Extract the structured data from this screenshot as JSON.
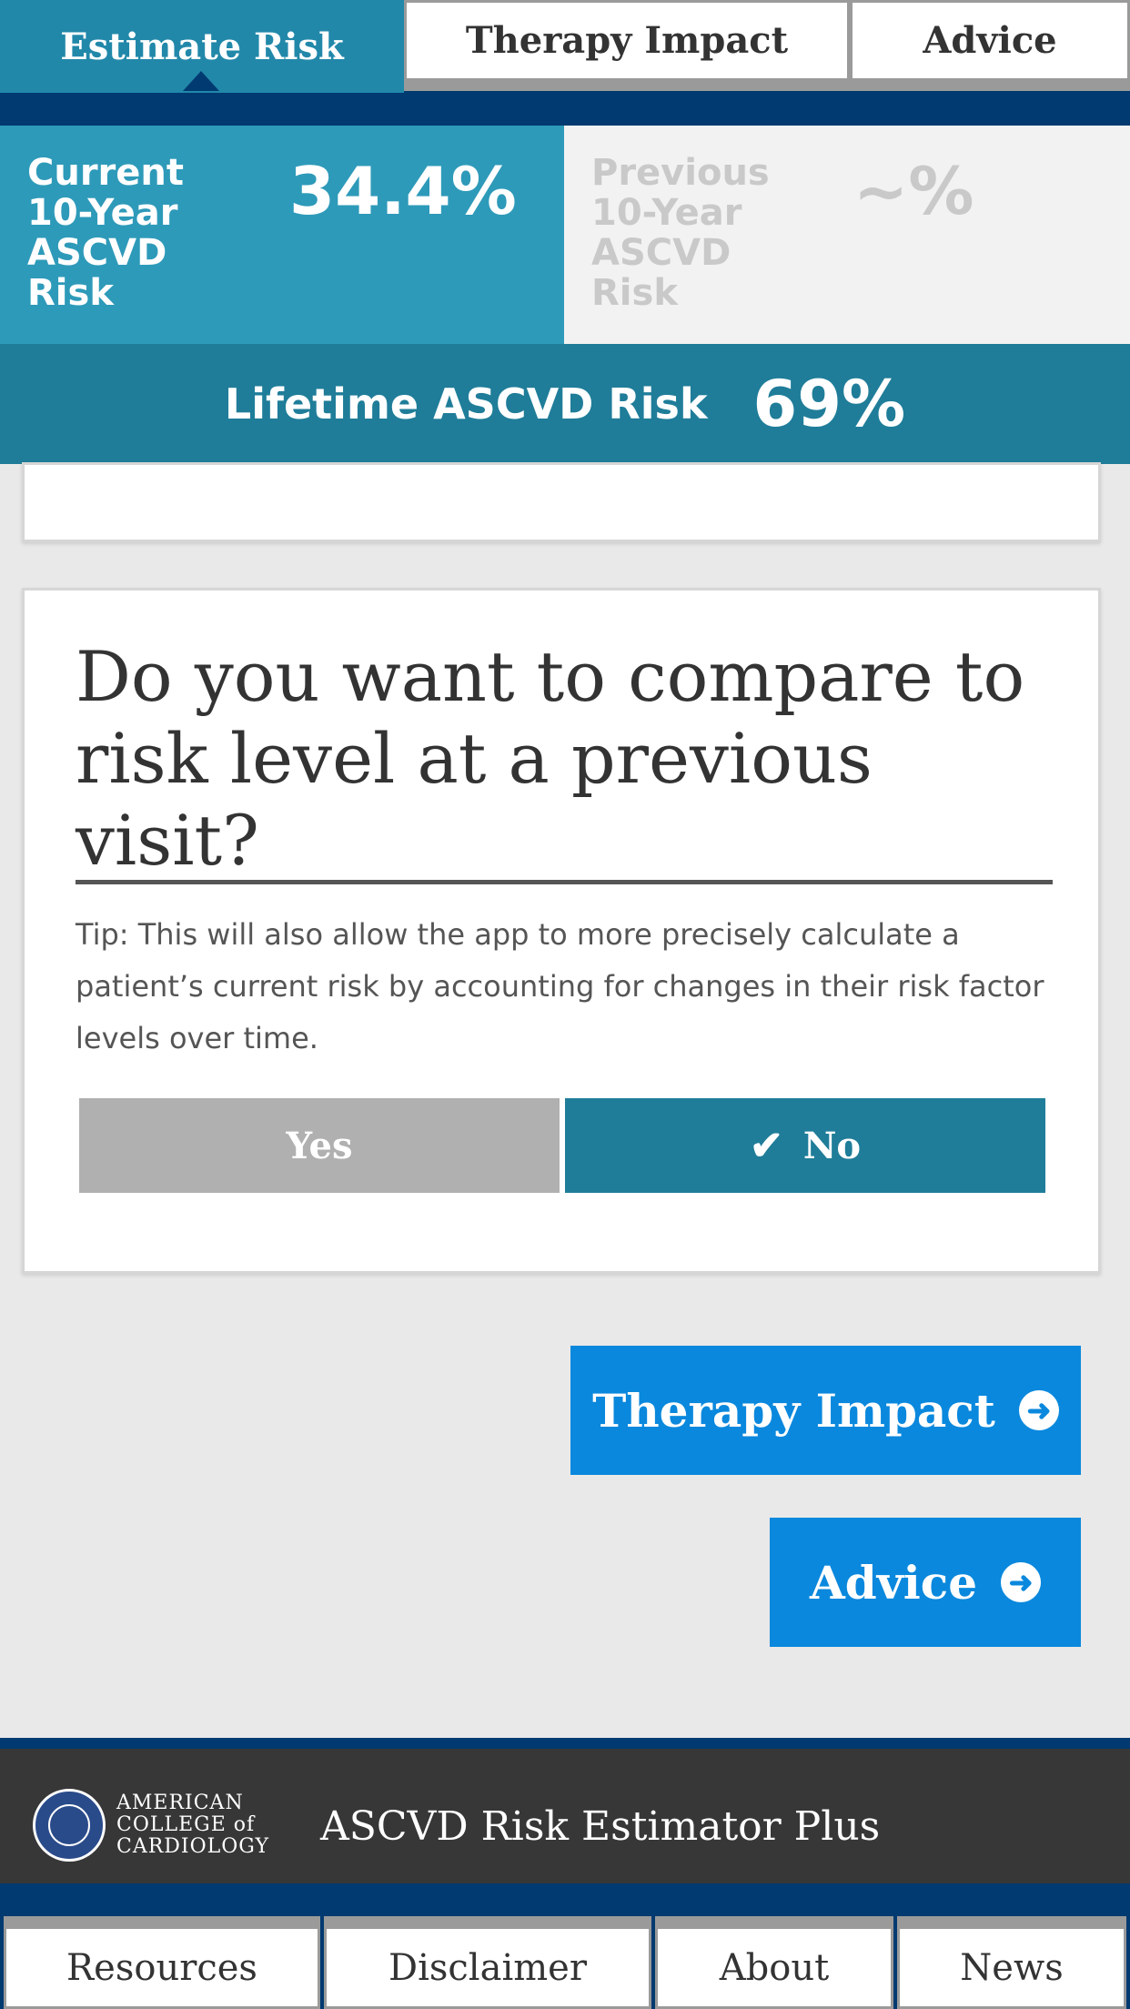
{
  "tabs": [
    {
      "label": "Estimate Risk",
      "active": true
    },
    {
      "label": "Therapy Impact",
      "active": false
    },
    {
      "label": "Advice",
      "active": false
    }
  ],
  "risk": {
    "current_label": "Current 10-Year ASCVD Risk",
    "current_value": "34.4%",
    "previous_label": "Previous 10-Year ASCVD Risk",
    "previous_value": "~%",
    "lifetime_label": "Lifetime ASCVD Risk",
    "lifetime_value": "69%"
  },
  "question": {
    "text": "Do you want to compare to risk level at a previous visit?",
    "tip": "Tip: This will also allow the app to more precisely calculate a patient’s current risk by accounting for changes in their risk factor levels over time.",
    "yes_label": "Yes",
    "no_label": "No",
    "selected": "No"
  },
  "nav": {
    "therapy_label": "Therapy Impact",
    "advice_label": "Advice"
  },
  "footer": {
    "org_line1": "AMERICAN",
    "org_line2": "COLLEGE of",
    "org_line3": "CARDIOLOGY",
    "app_title": "ASCVD Risk Estimator Plus"
  },
  "bottom_tabs": [
    "Resources",
    "Disclaimer",
    "About",
    "News"
  ],
  "colors": {
    "primary": "#2e9ab9",
    "dark_teal": "#1f7d99",
    "navy": "#003a70",
    "button_blue": "#0a88dd"
  }
}
